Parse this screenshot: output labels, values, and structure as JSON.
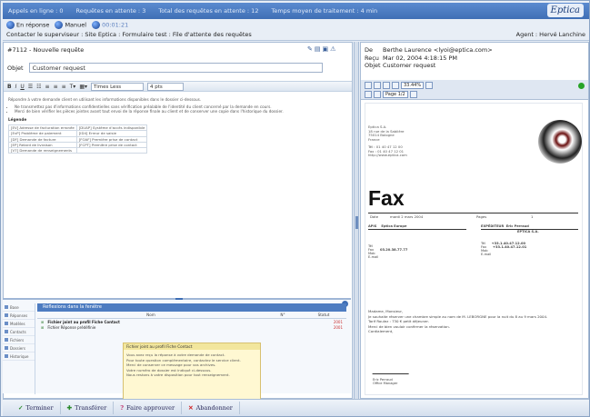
{
  "topbar": {
    "stats": [
      "Appels en ligne : 0",
      "Requêtes en attente : 3",
      "Total des requêtes en attente : 12",
      "Temps moyen de traitement : 4 min"
    ],
    "logo": "Eptica"
  },
  "status": {
    "available_label": "En réponse",
    "manual_label": "Manuel",
    "timer": "00:01:21"
  },
  "context": {
    "path": "Contacter le superviseur : Site Eptica : Formulaire test : File d'attente des requêtes",
    "agent": "Agent : Hervé Lanchine"
  },
  "compose": {
    "subject": "#7112 - Nouvelle requête",
    "object_label": "Objet",
    "object_value": "Customer request",
    "font_select": "Times Less",
    "size_select": "4 pts",
    "body_intro": "Répondre à votre demande client en utilisant les informations disponibles dans le dossier ci-dessous.",
    "bullets": [
      "Ne transmettez pas d'informations confidentielles sans vérification préalable de l'identité du client concerné par la demande en cours.",
      "Merci de bien vérifier les pièces jointes avant tout envoi de la réponse finale au client et de conserver une copie dans l'historique du dossier."
    ],
    "legend_label": "Légende",
    "legend_rows": [
      [
        "[EV] Adresse de facturation erronée",
        "[DUAP] Système d'accès indisponible"
      ],
      [
        "[EvP] Problème de paiement",
        "[ID4] Erreur de saisie"
      ],
      [
        "[DF] Demande de facture",
        "[FOAF] Première prise de contact"
      ],
      [
        "[EP] Retard de livraison",
        "[FCPT] Première prise de contact"
      ],
      [
        "[V7] Demande de renseignements",
        ""
      ]
    ]
  },
  "bottom": {
    "header": "Réflexions dans la fenêtre",
    "col_name": "Nom",
    "col_num": "N°",
    "col_status": "Statut",
    "rows": [
      {
        "label": "Fichier joint au profil Fiche Contact",
        "flag": "2001"
      },
      {
        "label": "Fichier Réponse prédéfinie",
        "flag": "2001"
      }
    ],
    "side_items": [
      "Base",
      "Réponses",
      "Modèles",
      "Contacts",
      "Fichiers",
      "Dossiers",
      "Historique"
    ],
    "popup_title": "Fichier joint au profil Fiche Contact",
    "popup_lines": [
      "Vous avez reçu la réponse à votre demande de contact.",
      "Pour toute question complémentaire, contactez le service client.",
      "Merci de conserver ce message pour vos archives.",
      "Votre numéro de dossier est indiqué ci-dessous.",
      "Nous restons à votre disposition pour tout renseignement."
    ]
  },
  "actions": [
    {
      "icon": "check-icon",
      "label": "Terminer"
    },
    {
      "icon": "transfer-icon",
      "label": "Transférer"
    },
    {
      "icon": "approve-icon",
      "label": "Faire approuver"
    },
    {
      "icon": "abandon-icon",
      "label": "Abandonner"
    }
  ],
  "message": {
    "de_label": "De",
    "de_value": "Berthe Laurence <lyoi@eptica.com>",
    "recu_label": "Reçu",
    "recu_value": "Mar 02, 2004 4:18:15 PM",
    "objet_label": "Objet",
    "objet_value": "Customer request",
    "zoom": "33.44%",
    "page": "Page 1/2"
  },
  "fax": {
    "sender_lines": [
      "Eptica S.A.",
      "18 rue de la Sablière",
      "75014 Bologne",
      "France",
      "Tél : 01 40 47 12 00",
      "Fax : 01 40 47 12 01",
      "http://www.eptica.com"
    ],
    "title": "Fax",
    "header_cells": [
      "Date",
      "mardi 2 mars 2004",
      "Pages",
      "1"
    ],
    "left_block": [
      "APIS",
      "Eptica Europe",
      "Tél",
      "Fax",
      "Mob",
      "E-mail"
    ],
    "left_values": [
      "",
      "",
      "",
      "03.20.38.77.77",
      "",
      ""
    ],
    "right_block": [
      "EXPÉDITEUR",
      "Eric Perraud",
      "EPTICA S.A.",
      "Tél",
      "Fax",
      "Mob",
      "E-mail"
    ],
    "right_values": [
      "",
      "",
      "",
      "+33.1.40.47.12.00",
      "+33.1.40.47.12.01",
      "",
      ""
    ],
    "text_lines": [
      "Madame, Monsieur,",
      "Je souhaite réserver une chambre simple au nom de M. LEBORGNE pour la nuit du 8 au 9 mars 2004.",
      "Tarif Roulez : 730 € petit déjeuner.",
      "Merci de bien vouloir confirmer la réservation.",
      "Cordialement,"
    ],
    "signature_name": "Eric Perraud",
    "signature_title": "Office Manager"
  }
}
